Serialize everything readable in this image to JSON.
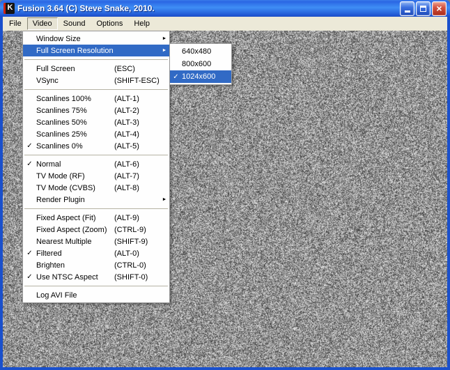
{
  "window": {
    "title": "Fusion 3.64 (C) Steve Snake, 2010.",
    "icon_letter": "K"
  },
  "glyphs": {
    "check": "✓",
    "submenu_arrow": "►",
    "close": "×"
  },
  "menubar": {
    "items": [
      {
        "label": "File"
      },
      {
        "label": "Video",
        "active": true
      },
      {
        "label": "Sound"
      },
      {
        "label": "Options"
      },
      {
        "label": "Help"
      }
    ]
  },
  "video_menu": {
    "items": [
      {
        "label": "Window Size",
        "submenu": true
      },
      {
        "label": "Full Screen Resolution",
        "submenu": true,
        "highlighted": true
      },
      {
        "separator": true
      },
      {
        "label": "Full Screen",
        "shortcut": "(ESC)"
      },
      {
        "label": "VSync",
        "shortcut": "(SHIFT-ESC)"
      },
      {
        "separator": true
      },
      {
        "label": "Scanlines 100%",
        "shortcut": "(ALT-1)"
      },
      {
        "label": "Scanlines 75%",
        "shortcut": "(ALT-2)"
      },
      {
        "label": "Scanlines 50%",
        "shortcut": "(ALT-3)"
      },
      {
        "label": "Scanlines 25%",
        "shortcut": "(ALT-4)"
      },
      {
        "label": "Scanlines 0%",
        "shortcut": "(ALT-5)",
        "checked": true
      },
      {
        "separator": true
      },
      {
        "label": "Normal",
        "shortcut": "(ALT-6)",
        "checked": true
      },
      {
        "label": "TV Mode (RF)",
        "shortcut": "(ALT-7)"
      },
      {
        "label": "TV Mode (CVBS)",
        "shortcut": "(ALT-8)"
      },
      {
        "label": "Render Plugin",
        "submenu": true
      },
      {
        "separator": true
      },
      {
        "label": "Fixed Aspect (Fit)",
        "shortcut": "(ALT-9)"
      },
      {
        "label": "Fixed Aspect (Zoom)",
        "shortcut": "(CTRL-9)"
      },
      {
        "label": "Nearest Multiple",
        "shortcut": "(SHIFT-9)"
      },
      {
        "label": "Filtered",
        "shortcut": "(ALT-0)",
        "checked": true
      },
      {
        "label": "Brighten",
        "shortcut": "(CTRL-0)"
      },
      {
        "label": "Use NTSC Aspect",
        "shortcut": "(SHIFT-0)",
        "checked": true
      },
      {
        "separator": true
      },
      {
        "label": "Log AVI File"
      }
    ]
  },
  "resolution_submenu": {
    "items": [
      {
        "label": "640x480"
      },
      {
        "label": "800x600"
      },
      {
        "label": "1024x600",
        "checked": true,
        "highlighted": true
      }
    ]
  },
  "colors": {
    "selection_blue": "#316ac5",
    "titlebar_blue": "#2a66e4",
    "close_red": "#d35240",
    "menubar_bg": "#ece9d8"
  }
}
